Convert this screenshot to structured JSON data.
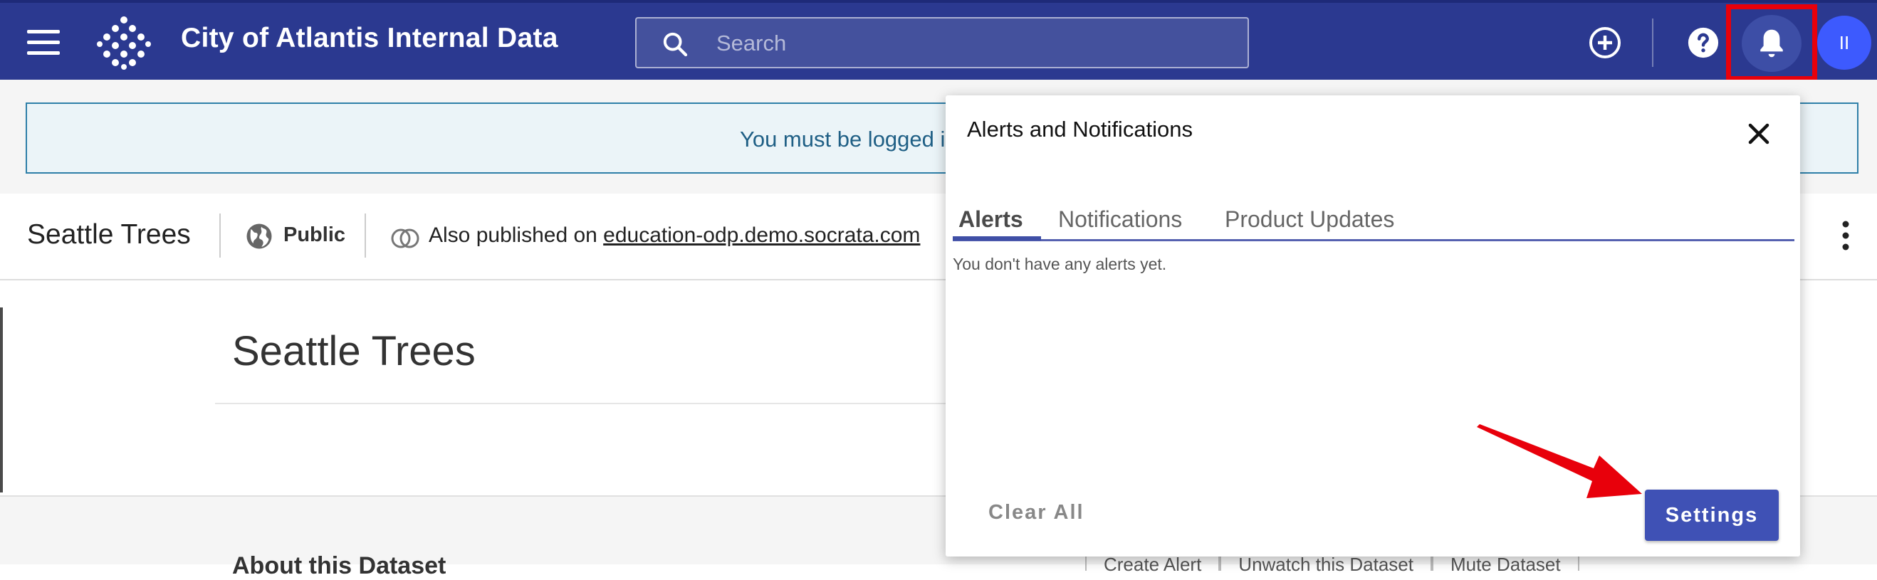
{
  "app": {
    "title": "City of Atlantis Internal Data",
    "search_placeholder": "Search",
    "avatar_initials": "II",
    "brand_color": "#2b3990"
  },
  "banner": {
    "text": "You must be logged in"
  },
  "dataset": {
    "name": "Seattle Trees",
    "visibility": "Public",
    "published_prefix": "Also published on ",
    "published_domain": "education-odp.demo.socrata.com"
  },
  "main": {
    "title": "Seattle Trees",
    "section_heading": "About this Dataset",
    "footer_buttons": [
      "Create Alert",
      "Unwatch this Dataset",
      "Mute Dataset"
    ]
  },
  "popup": {
    "title": "Alerts and Notifications",
    "tabs": [
      "Alerts",
      "Notifications",
      "Product Updates"
    ],
    "active_tab": "Alerts",
    "empty_message": "You don't have any alerts yet.",
    "clear_all_label": "Clear All",
    "settings_label": "Settings",
    "accent_color": "#3f51b5"
  },
  "icons": {
    "menu": "hamburger-icon",
    "logo": "socrata-logo",
    "search": "search-icon",
    "add": "add-circle-icon",
    "help": "help-icon",
    "bell": "bell-icon",
    "globe": "globe-icon",
    "federation": "linked-circles-icon",
    "more": "more-vertical-icon",
    "close": "close-icon"
  },
  "annotation": {
    "highlight_color": "#e8000b"
  }
}
